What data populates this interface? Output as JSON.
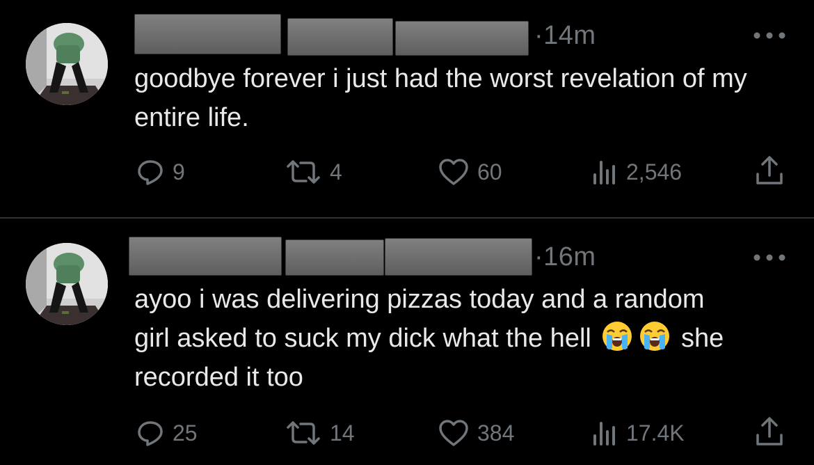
{
  "tweets": [
    {
      "time": "·14m",
      "text": "goodbye forever i just had the worst revelation of my entire life.",
      "replies": "9",
      "retweets": "4",
      "likes": "60",
      "views": "2,546"
    },
    {
      "time": "·16m",
      "text_before": "ayoo i was delivering pizzas today and a random girl asked to suck my dick what the hell",
      "text_after": "she recorded it too",
      "emoji": "😭",
      "replies": "25",
      "retweets": "14",
      "likes": "384",
      "views": "17.4K"
    }
  ],
  "icons": {
    "reply": "reply-icon",
    "retweet": "retweet-icon",
    "like": "heart-icon",
    "views": "views-icon",
    "share": "share-icon",
    "more": "more-dots-icon"
  },
  "colors": {
    "background": "#000000",
    "text": "#e7e9ea",
    "muted": "#71767b",
    "divider": "#2f3336"
  }
}
